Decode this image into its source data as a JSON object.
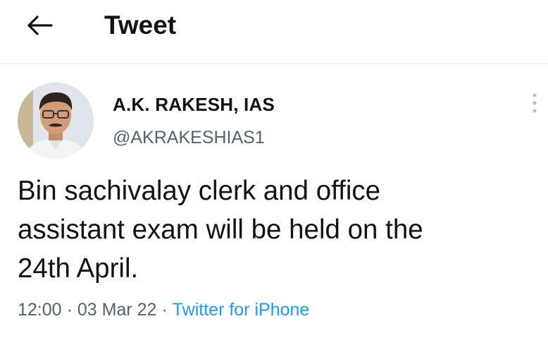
{
  "header": {
    "back_icon": "arrow-left-icon",
    "title": "Tweet"
  },
  "tweet": {
    "author": {
      "name": "A.K. RAKESH, IAS",
      "handle": "@AKRAKESHIAS1",
      "avatar": "profile-photo"
    },
    "more_icon": "more-vertical-icon",
    "text": "Bin sachivalay clerk and office\nassistant exam will be held on the\n24th April.",
    "time": "12:00",
    "date": "03 Mar 22",
    "separator": "·",
    "source": "Twitter for iPhone"
  },
  "colors": {
    "text_primary": "#0f1419",
    "text_secondary": "#536471",
    "link": "#1d9bf0",
    "divider": "#e7e9ea"
  }
}
